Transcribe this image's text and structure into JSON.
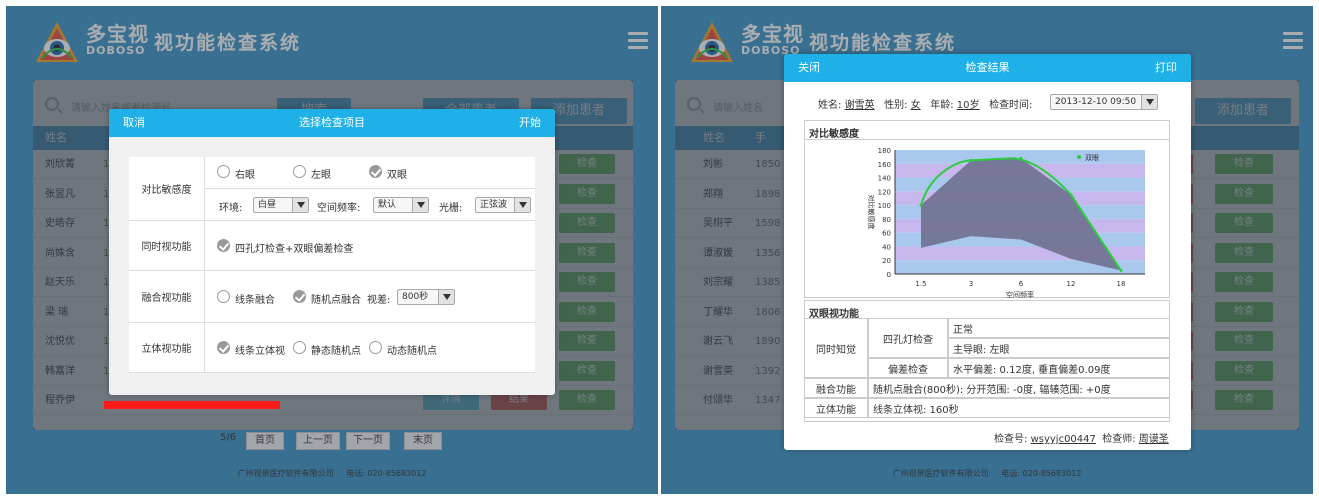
{
  "app": {
    "logo_cn": "多宝视",
    "logo_en": "DOBOSO",
    "title": "视功能检查系统",
    "footer_company": "广州视景医疗软件有限公司",
    "footer_phone": "电话: 020-85683012"
  },
  "left": {
    "search_placeholder": "请输入姓名或者检测号",
    "search_btn": "搜索",
    "all_patients_btn": "全部患者",
    "add_patient_btn": "添加患者",
    "col_name": "姓名",
    "rows": [
      {
        "name": "刘欣菁",
        "phone": "1"
      },
      {
        "name": "张昱凡",
        "phone": "1"
      },
      {
        "name": "史皓存",
        "phone": "1"
      },
      {
        "name": "尚姝含",
        "phone": "1"
      },
      {
        "name": "赵天乐",
        "phone": "1"
      },
      {
        "name": "梁 瑞",
        "phone": "1"
      },
      {
        "name": "沈悦优",
        "phone": "1"
      },
      {
        "name": "韩嘉洋",
        "phone": "1"
      },
      {
        "name": "程乔伊",
        "phone": ""
      }
    ],
    "check_btn": "检查",
    "detail_btn": "详情",
    "result_btn": "结果",
    "page_info": "5/6",
    "first_page": "首页",
    "prev_page": "上一页",
    "next_page": "下一页",
    "last_page": "末页",
    "dialog": {
      "cancel": "取消",
      "title": "选择检查项目",
      "start": "开始",
      "contrast_label": "对比敏感度",
      "right_eye": "右眼",
      "left_eye": "左眼",
      "both_eyes": "双眼",
      "env_label": "环境:",
      "env_value": "白昼",
      "freq_label": "空间频率:",
      "freq_value": "默认",
      "grating_label": "光栅:",
      "grating_value": "正弦波",
      "simul_label": "同时视功能",
      "simul_opt": "四孔灯检查+双眼偏差检查",
      "fusion_label": "融合视功能",
      "fusion_line": "线条融合",
      "fusion_random": "随机点融合",
      "parallax_label": "视差:",
      "parallax_value": "800秒",
      "stereo_label": "立体视功能",
      "stereo_line": "线条立体视",
      "stereo_static": "静态随机点",
      "stereo_dynamic": "动态随机点"
    }
  },
  "right": {
    "search_placeholder": "请输入姓名",
    "add_patient_btn": "添加患者",
    "col_name": "姓名",
    "col_phone": "手",
    "rows": [
      {
        "name": "刘彬",
        "phone": "1850"
      },
      {
        "name": "郑翔",
        "phone": "1898"
      },
      {
        "name": "吴栩平",
        "phone": "1598"
      },
      {
        "name": "谭淑媛",
        "phone": "1356"
      },
      {
        "name": "刘宗耀",
        "phone": "1385"
      },
      {
        "name": "丁耀华",
        "phone": "1806"
      },
      {
        "name": "谢云飞",
        "phone": "1890"
      },
      {
        "name": "谢雪英",
        "phone": "1392"
      },
      {
        "name": "付颂华",
        "phone": "1347"
      }
    ],
    "check_btn": "检查",
    "report": {
      "close": "关闭",
      "title": "检查结果",
      "print": "打印",
      "name_label": "姓名:",
      "name_value": "谢雪英",
      "sex_label": "性别:",
      "sex_value": "女",
      "age_label": "年龄:",
      "age_value": "10岁",
      "time_label": "检查时间:",
      "time_value": "2013-12-10 09:50",
      "contrast_title": "对比敏感度",
      "binocular_title": "双眼视功能",
      "simultaneous": "同时知觉",
      "four_dot": "四孔灯检查",
      "four_dot_result": "正常",
      "dominant_eye": "主导眼: 左眼",
      "deviation": "偏差检查",
      "deviation_result": "水平偏差: 0.12度, 垂直偏差0.09度",
      "fusion": "融合功能",
      "fusion_result": "随机点融合(800秒): 分开范围: -0度, 辐辏范围: +0度",
      "stereo": "立体功能",
      "stereo_result": "线条立体视: 160秒",
      "exam_no_label": "检查号:",
      "exam_no_value": "wsyyjc00447",
      "examiner_label": "检查师:",
      "examiner_value": "周谟圣"
    }
  },
  "chart_data": {
    "type": "area",
    "ylabel": "对比敏感度",
    "xlabel": "空间频率",
    "x_ticks": [
      "1.5",
      "3",
      "6",
      "12",
      "18"
    ],
    "y_ticks": [
      0,
      20,
      40,
      60,
      80,
      100,
      120,
      140,
      160,
      180
    ],
    "ylim": [
      0,
      180
    ],
    "legend": "双眼",
    "grid": true,
    "series": [
      {
        "name": "双眼",
        "x": [
          "1.5",
          "3",
          "6",
          "12",
          "18"
        ],
        "values": [
          100,
          165,
          168,
          115,
          5
        ]
      }
    ],
    "lower_band": [
      38,
      55,
      50,
      22,
      5
    ],
    "colors": {
      "line": "#2ecc40",
      "fill": "#6b6b8a",
      "stripe_a": "#c6b8ee",
      "stripe_b": "#a8c8ee"
    }
  }
}
